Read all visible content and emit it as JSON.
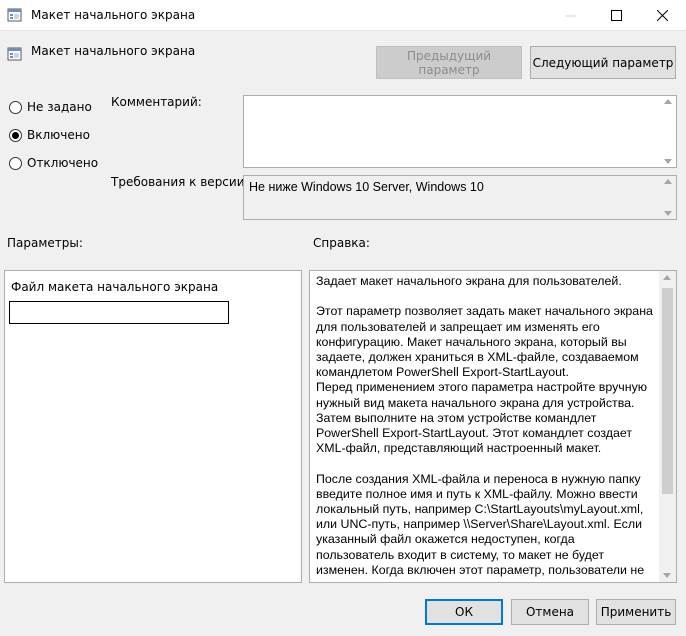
{
  "window": {
    "title": "Макет начального экрана"
  },
  "header": {
    "policy_name": "Макет начального экрана",
    "prev_button": "Предыдущий параметр",
    "next_button": "Следующий параметр"
  },
  "state": {
    "options": [
      {
        "label": "Не задано",
        "checked": false
      },
      {
        "label": "Включено",
        "checked": true
      },
      {
        "label": "Отключено",
        "checked": false
      }
    ]
  },
  "comment": {
    "label": "Комментарий:",
    "value": ""
  },
  "supported_on": {
    "label": "Требования к версии:",
    "value": "Не ниже Windows 10 Server, Windows 10"
  },
  "options_section": {
    "label": "Параметры:",
    "file_label": "Файл макета начального экрана",
    "file_value": ""
  },
  "help_section": {
    "label": "Справка:",
    "paragraphs": [
      "Задает макет начального экрана для пользователей.",
      "Этот параметр позволяет задать макет начального экрана для пользователей и запрещает им изменять его конфигурацию. Макет начального экрана, который вы задаете, должен храниться в XML-файле, создаваемом командлетом PowerShell Export-StartLayout.",
      "Перед применением этого параметра настройте вручную нужный вид макета начального экрана для устройства. Затем выполните на этом устройстве командлет PowerShell Export-StartLayout. Этот командлет создает XML-файл, представляющий настроенный макет.",
      "После создания XML-файла и переноса в нужную папку введите полное имя и путь к XML-файлу. Можно ввести локальный путь, например C:\\StartLayouts\\myLayout.xml, или UNC-путь, например \\\\Server\\Share\\Layout.xml. Если указанный файл окажется недоступен, когда пользователь входит в систему, то макет не будет изменен. Когда включен этот параметр, пользователи не могут настраивать"
    ]
  },
  "footer": {
    "ok": "ОК",
    "cancel": "Отмена",
    "apply": "Применить"
  },
  "colors": {
    "accent": "#0078d7",
    "window_bg": "#f0f0f0"
  }
}
